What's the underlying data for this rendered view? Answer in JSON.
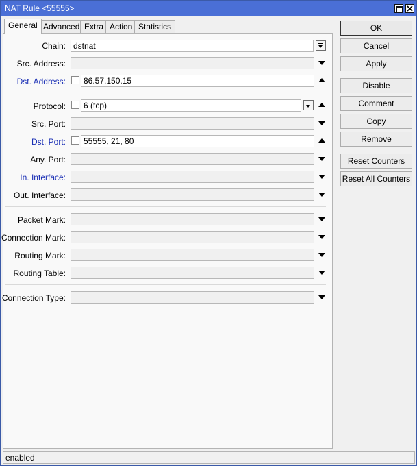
{
  "window": {
    "title": "NAT Rule <55555>"
  },
  "tabs": [
    "General",
    "Advanced",
    "Extra",
    "Action",
    "Statistics"
  ],
  "fields": {
    "chain": {
      "label": "Chain:",
      "value": "dstnat"
    },
    "src_address": {
      "label": "Src. Address:",
      "value": ""
    },
    "dst_address": {
      "label": "Dst. Address:",
      "value": "86.57.150.15"
    },
    "protocol": {
      "label": "Protocol:",
      "value": "6 (tcp)"
    },
    "src_port": {
      "label": "Src. Port:",
      "value": ""
    },
    "dst_port": {
      "label": "Dst. Port:",
      "value": "55555, 21, 80"
    },
    "any_port": {
      "label": "Any. Port:",
      "value": ""
    },
    "in_interface": {
      "label": "In. Interface:",
      "value": ""
    },
    "out_interface": {
      "label": "Out. Interface:",
      "value": ""
    },
    "packet_mark": {
      "label": "Packet Mark:",
      "value": ""
    },
    "connection_mark": {
      "label": "Connection Mark:",
      "value": ""
    },
    "routing_mark": {
      "label": "Routing Mark:",
      "value": ""
    },
    "routing_table": {
      "label": "Routing Table:",
      "value": ""
    },
    "connection_type": {
      "label": "Connection Type:",
      "value": ""
    }
  },
  "buttons": {
    "ok": "OK",
    "cancel": "Cancel",
    "apply": "Apply",
    "disable": "Disable",
    "comment": "Comment",
    "copy": "Copy",
    "remove": "Remove",
    "reset_counters": "Reset Counters",
    "reset_all_counters": "Reset All Counters"
  },
  "status": {
    "text": "enabled"
  },
  "colors": {
    "titlebar": "#4a6fd6",
    "active_label": "#1a2fb5"
  }
}
